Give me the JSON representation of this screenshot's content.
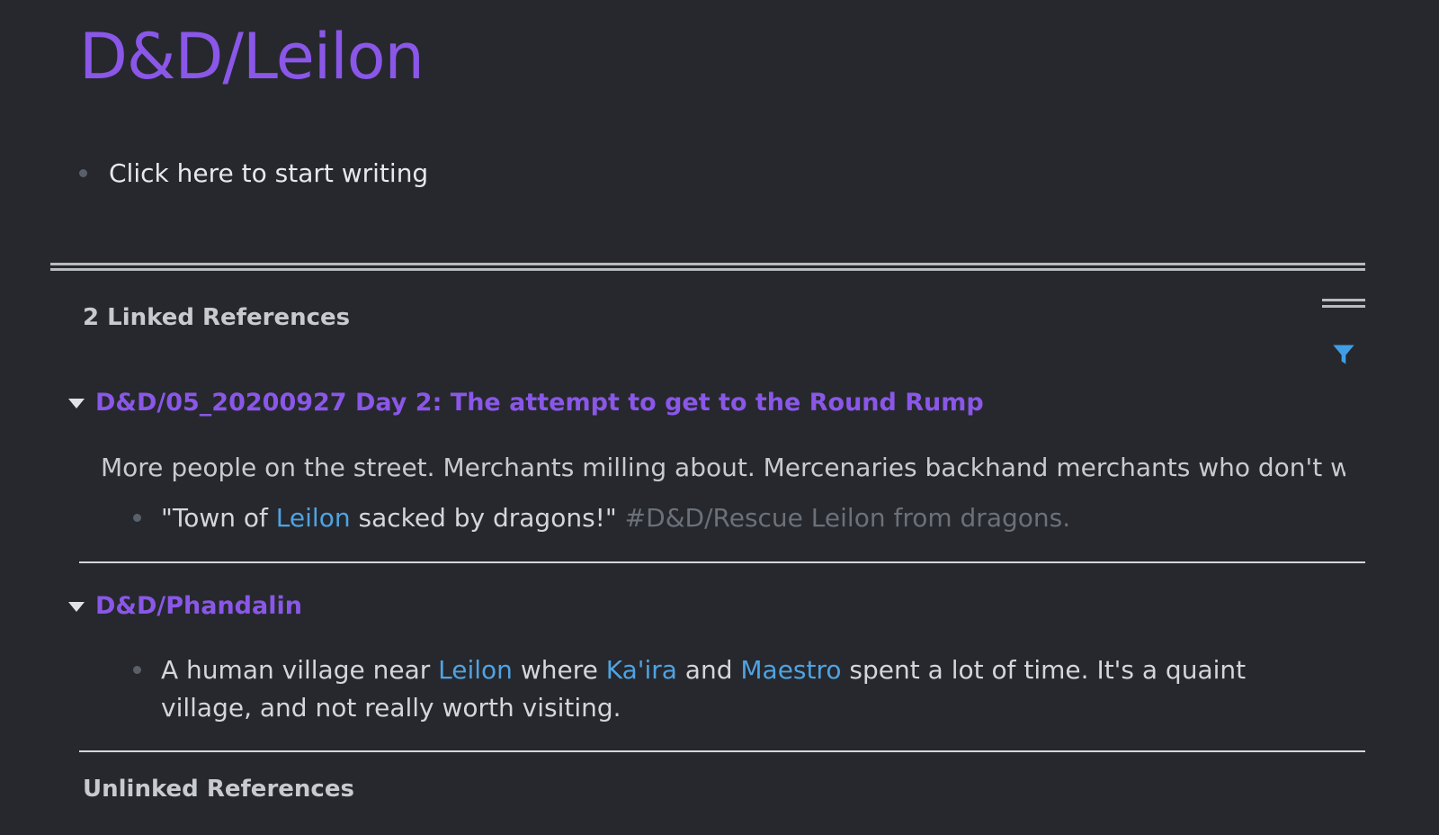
{
  "page": {
    "title": "D&D/Leilon",
    "starter_text": "Click here to start writing"
  },
  "linked_refs": {
    "header": "2 Linked References",
    "groups": [
      {
        "title": "D&D/05_20200927 Day 2: The attempt to get to the Round Rump",
        "context": "More people on the street. Merchants milling about. Mercenaries backhand merchants who don't want to",
        "block": {
          "prefix": "\"Town of ",
          "link": "Leilon",
          "middle": " sacked by dragons!\" ",
          "tag": "#D&D/Rescue Leilon from dragons."
        }
      },
      {
        "title": "D&D/Phandalin",
        "block": {
          "part1": "A human village near ",
          "link1": "Leilon",
          "part2": " where ",
          "link2": "Ka'ira",
          "part3": " and ",
          "link3": "Maestro",
          "part4": " spent a lot of time. It's a quaint village, and not really worth visiting."
        }
      }
    ]
  },
  "unlinked_refs": {
    "header": "Unlinked References"
  },
  "icons": {
    "filter": "filter-icon",
    "menu": "menu-lines-icon",
    "caret": "caret-down-icon"
  },
  "colors": {
    "background": "#26282d",
    "title": "#8a57e8",
    "link": "#4fa3e3",
    "tag": "#6b7079",
    "filter": "#3f9fe6"
  }
}
